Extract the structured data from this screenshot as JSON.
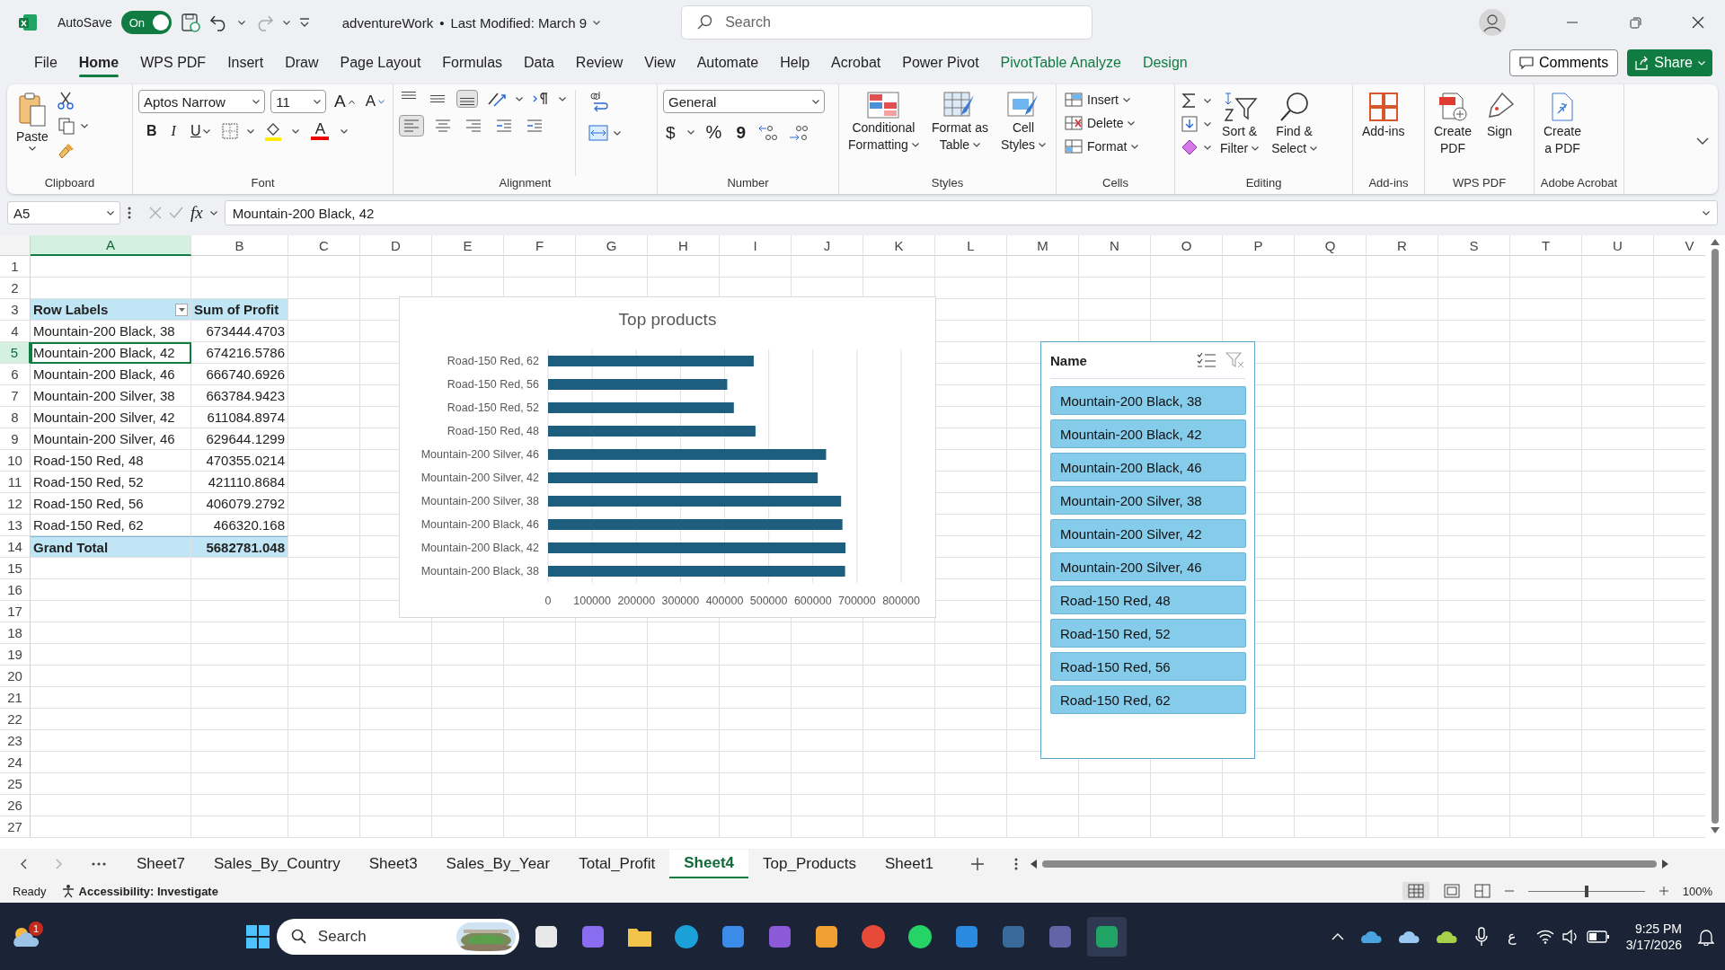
{
  "title_bar": {
    "autosave_label": "AutoSave",
    "autosave_on": true,
    "autosave_state": "On",
    "file_title": "adventureWork",
    "separator": "•",
    "modified": "Last Modified: March 9",
    "search_placeholder": "Search"
  },
  "menu_tabs": [
    {
      "label": "File",
      "selected": false,
      "contextual": false
    },
    {
      "label": "Home",
      "selected": true,
      "contextual": false
    },
    {
      "label": "WPS PDF",
      "selected": false,
      "contextual": false
    },
    {
      "label": "Insert",
      "selected": false,
      "contextual": false
    },
    {
      "label": "Draw",
      "selected": false,
      "contextual": false
    },
    {
      "label": "Page Layout",
      "selected": false,
      "contextual": false
    },
    {
      "label": "Formulas",
      "selected": false,
      "contextual": false
    },
    {
      "label": "Data",
      "selected": false,
      "contextual": false
    },
    {
      "label": "Review",
      "selected": false,
      "contextual": false
    },
    {
      "label": "View",
      "selected": false,
      "contextual": false
    },
    {
      "label": "Automate",
      "selected": false,
      "contextual": false
    },
    {
      "label": "Help",
      "selected": false,
      "contextual": false
    },
    {
      "label": "Acrobat",
      "selected": false,
      "contextual": false
    },
    {
      "label": "Power Pivot",
      "selected": false,
      "contextual": false
    },
    {
      "label": "PivotTable Analyze",
      "selected": false,
      "contextual": true
    },
    {
      "label": "Design",
      "selected": false,
      "contextual": true
    }
  ],
  "header_buttons": {
    "comments": "Comments",
    "share": "Share"
  },
  "ribbon": {
    "clipboard": {
      "paste": "Paste",
      "label": "Clipboard"
    },
    "font": {
      "family": "Aptos Narrow",
      "size": "11",
      "grow": "A",
      "shrink": "A",
      "bold": "B",
      "italic": "I",
      "underline": "U",
      "font_color": "A",
      "label": "Font"
    },
    "alignment": {
      "label": "Alignment"
    },
    "number": {
      "format": "General",
      "currency": "$",
      "percent": "%",
      "comma": "9",
      "label": "Number"
    },
    "styles": {
      "buttons": [
        {
          "lines": [
            "Conditional",
            "Formatting"
          ]
        },
        {
          "lines": [
            "Format as",
            "Table"
          ]
        },
        {
          "lines": [
            "Cell",
            "Styles"
          ]
        }
      ],
      "label": "Styles"
    },
    "cells": {
      "buttons": [
        "Insert",
        "Delete",
        "Format"
      ],
      "label": "Cells"
    },
    "editing": {
      "buttons": [
        {
          "lines": [
            "Sort &",
            "Filter"
          ]
        },
        {
          "lines": [
            "Find &",
            "Select"
          ]
        }
      ],
      "label": "Editing"
    },
    "addins": {
      "buttons": [
        {
          "lines": [
            "Add-ins"
          ]
        }
      ],
      "label": "Add-ins"
    },
    "wps_pdf": {
      "buttons": [
        {
          "lines": [
            "Create",
            "PDF"
          ]
        },
        {
          "lines": [
            "Sign"
          ]
        }
      ],
      "label": "WPS PDF"
    },
    "acrobat": {
      "buttons": [
        {
          "lines": [
            "Create",
            "a PDF"
          ]
        }
      ],
      "label": "Adobe Acrobat"
    }
  },
  "formula_bar": {
    "name_box": "A5",
    "fx": "fx",
    "formula": "Mountain-200 Black, 42"
  },
  "columns": [
    {
      "label": "A",
      "selected": true
    },
    {
      "label": "B",
      "selected": false
    },
    {
      "label": "C",
      "selected": false
    },
    {
      "label": "D",
      "selected": false
    },
    {
      "label": "E",
      "selected": false
    },
    {
      "label": "F",
      "selected": false
    },
    {
      "label": "G",
      "selected": false
    },
    {
      "label": "H",
      "selected": false
    },
    {
      "label": "I",
      "selected": false
    },
    {
      "label": "J",
      "selected": false
    },
    {
      "label": "K",
      "selected": false
    },
    {
      "label": "L",
      "selected": false
    },
    {
      "label": "M",
      "selected": false
    },
    {
      "label": "N",
      "selected": false
    },
    {
      "label": "O",
      "selected": false
    },
    {
      "label": "P",
      "selected": false
    },
    {
      "label": "Q",
      "selected": false
    },
    {
      "label": "R",
      "selected": false
    },
    {
      "label": "S",
      "selected": false
    },
    {
      "label": "T",
      "selected": false
    },
    {
      "label": "U",
      "selected": false
    },
    {
      "label": "V",
      "selected": false
    }
  ],
  "rows": [
    {
      "label": "1",
      "selected": false
    },
    {
      "label": "2",
      "selected": false
    },
    {
      "label": "3",
      "selected": false
    },
    {
      "label": "4",
      "selected": false
    },
    {
      "label": "5",
      "selected": true
    },
    {
      "label": "6",
      "selected": false
    },
    {
      "label": "7",
      "selected": false
    },
    {
      "label": "8",
      "selected": false
    },
    {
      "label": "9",
      "selected": false
    },
    {
      "label": "10",
      "selected": false
    },
    {
      "label": "11",
      "selected": false
    },
    {
      "label": "12",
      "selected": false
    },
    {
      "label": "13",
      "selected": false
    },
    {
      "label": "14",
      "selected": false
    },
    {
      "label": "15",
      "selected": false
    },
    {
      "label": "16",
      "selected": false
    },
    {
      "label": "17",
      "selected": false
    },
    {
      "label": "18",
      "selected": false
    },
    {
      "label": "19",
      "selected": false
    },
    {
      "label": "20",
      "selected": false
    },
    {
      "label": "21",
      "selected": false
    },
    {
      "label": "22",
      "selected": false
    },
    {
      "label": "23",
      "selected": false
    },
    {
      "label": "24",
      "selected": false
    },
    {
      "label": "25",
      "selected": false
    },
    {
      "label": "26",
      "selected": false
    },
    {
      "label": "27",
      "selected": false
    }
  ],
  "pivot": {
    "headers": [
      "Row Labels",
      "Sum of Profit"
    ],
    "rows": [
      {
        "label": "Mountain-200 Black, 38",
        "value": "673444.4703",
        "selected": false
      },
      {
        "label": "Mountain-200 Black, 42",
        "value": "674216.5786",
        "selected": true
      },
      {
        "label": "Mountain-200 Black, 46",
        "value": "666740.6926",
        "selected": false
      },
      {
        "label": "Mountain-200 Silver, 38",
        "value": "663784.9423",
        "selected": false
      },
      {
        "label": "Mountain-200 Silver, 42",
        "value": "611084.8974",
        "selected": false
      },
      {
        "label": "Mountain-200 Silver, 46",
        "value": "629644.1299",
        "selected": false
      },
      {
        "label": "Road-150 Red, 48",
        "value": "470355.0214",
        "selected": false
      },
      {
        "label": "Road-150 Red, 52",
        "value": "421110.8684",
        "selected": false
      },
      {
        "label": "Road-150 Red, 56",
        "value": "406079.2792",
        "selected": false
      },
      {
        "label": "Road-150 Red, 62",
        "value": "466320.168",
        "selected": false
      }
    ],
    "total": {
      "label": "Grand Total",
      "value": "5682781.048"
    }
  },
  "chart": {
    "chart_data": {
      "type": "bar",
      "orientation": "horizontal",
      "title": "Top products",
      "categories": [
        "Road-150 Red, 62",
        "Road-150 Red, 56",
        "Road-150 Red, 52",
        "Road-150 Red, 48",
        "Mountain-200 Silver, 46",
        "Mountain-200 Silver, 42",
        "Mountain-200 Silver, 38",
        "Mountain-200 Black, 46",
        "Mountain-200 Black, 42",
        "Mountain-200 Black, 38"
      ],
      "series": [
        {
          "color": "#1d5e7e",
          "values": [
            466000,
            406000,
            421000,
            470000,
            630000,
            611000,
            664000,
            667000,
            674000,
            673000
          ]
        }
      ],
      "grid": true,
      "xlim": [
        0,
        800000
      ],
      "xticks": [
        0,
        100000,
        200000,
        300000,
        400000,
        500000,
        600000,
        700000,
        800000
      ]
    }
  },
  "slicer": {
    "title": "Name",
    "items": [
      {
        "label": "Mountain-200 Black, 38",
        "selected": true
      },
      {
        "label": "Mountain-200 Black, 42",
        "selected": true
      },
      {
        "label": "Mountain-200 Black, 46",
        "selected": true
      },
      {
        "label": "Mountain-200 Silver, 38",
        "selected": true
      },
      {
        "label": "Mountain-200 Silver, 42",
        "selected": true
      },
      {
        "label": "Mountain-200 Silver, 46",
        "selected": true
      },
      {
        "label": "Road-150 Red, 48",
        "selected": true
      },
      {
        "label": "Road-150 Red, 52",
        "selected": true
      },
      {
        "label": "Road-150 Red, 56",
        "selected": true
      },
      {
        "label": "Road-150 Red, 62",
        "selected": true
      }
    ]
  },
  "sheet_tabs": [
    {
      "label": "Sheet7",
      "selected": false
    },
    {
      "label": "Sales_By_Country",
      "selected": false
    },
    {
      "label": "Sheet3",
      "selected": false
    },
    {
      "label": "Sales_By_Year",
      "selected": false
    },
    {
      "label": "Total_Profit",
      "selected": false
    },
    {
      "label": "Sheet4",
      "selected": true
    },
    {
      "label": "Top_Products",
      "selected": false
    },
    {
      "label": "Sheet1",
      "selected": false
    }
  ],
  "status_bar": {
    "ready": "Ready",
    "accessibility": "Accessibility: Investigate",
    "zoom": "100%",
    "zoom_slider": {
      "level": 0.5
    }
  },
  "taskbar": {
    "weather_badge": "1",
    "search_placeholder": "Search",
    "keyboard": "ع",
    "time": "9:25 PM",
    "date": "3/17/2026"
  }
}
